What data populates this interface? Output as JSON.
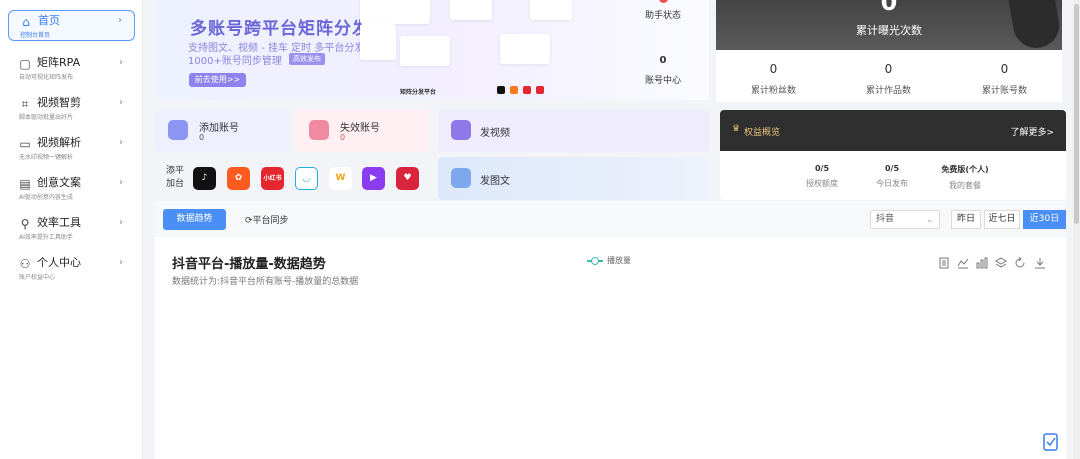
{
  "sidebar": {
    "items": [
      {
        "label": "首页",
        "sub": "控制台首页",
        "icon": "home-icon"
      },
      {
        "label": "矩阵RPA",
        "sub": "自动可视化矩阵发布",
        "icon": "rpa-icon"
      },
      {
        "label": "视频智剪",
        "sub": "脚本驱动批量出好片",
        "icon": "scissors-icon"
      },
      {
        "label": "视频解析",
        "sub": "无水印视频一键解析",
        "icon": "video-parse-icon"
      },
      {
        "label": "创意文案",
        "sub": "AI驱动创意内容生成",
        "icon": "copywriting-icon"
      },
      {
        "label": "效率工具",
        "sub": "AI效率提升工具助手",
        "icon": "tools-icon"
      },
      {
        "label": "个人中心",
        "sub": "账户权益中心",
        "icon": "user-icon"
      }
    ]
  },
  "banner": {
    "title": "多账号跨平台矩阵分发",
    "sub1": "支持图文、视频 - 挂车 定时 多平台分发",
    "sub2": "1000+账号同步管理",
    "tag": "高效发布",
    "button": "前去使用>>",
    "platform_title": "矩阵分发平台"
  },
  "assistant": {
    "status_label": "助手状态",
    "center_value": "0",
    "center_label": "账号中心"
  },
  "exposure": {
    "value": "0",
    "label": "累计曝光次数"
  },
  "totals": [
    {
      "value": "0",
      "label": "累计粉丝数"
    },
    {
      "value": "0",
      "label": "累计作品数"
    },
    {
      "value": "0",
      "label": "累计账号数"
    }
  ],
  "actions": {
    "add_account": {
      "label": "添加账号",
      "value": "0"
    },
    "invalid_account": {
      "label": "失效账号",
      "value": "0"
    },
    "post_video": {
      "label": "发视频"
    },
    "post_image": {
      "label": "发图文"
    },
    "add_platform": "添平加台"
  },
  "platforms": [
    {
      "name": "douyin-icon",
      "glyph": "♪",
      "color": "#111111"
    },
    {
      "name": "kuaishou-icon",
      "glyph": "✿",
      "color": "#ff5a1f"
    },
    {
      "name": "xiaohongshu-icon",
      "glyph": "小红书",
      "color": "#e6262e"
    },
    {
      "name": "bilibili-icon",
      "glyph": "◡",
      "color": "#ffffff"
    },
    {
      "name": "wechat-channels-icon",
      "glyph": "W",
      "color": "#ffffff"
    },
    {
      "name": "video-play-icon",
      "glyph": "▶",
      "color": "#8b3cf0"
    },
    {
      "name": "weishi-icon",
      "glyph": "♥",
      "color": "#d8243c"
    }
  ],
  "benefits": {
    "title": "权益概览",
    "more": "了解更多>",
    "stats": [
      {
        "value": "0/5",
        "label": "授权额度"
      },
      {
        "value": "0/5",
        "label": "今日发布"
      },
      {
        "value": "免费版(个人)",
        "label": "我的套餐"
      }
    ]
  },
  "tabs": {
    "trend": "数据趋势",
    "sync": "平台同步",
    "platform_select": "抖音",
    "ranges": [
      "昨日",
      "近七日",
      "近30日"
    ],
    "active_range": 2
  },
  "chart": {
    "title": "抖音平台-播放量-数据趋势",
    "description": "数据统计为:抖音平台所有账号-播放量的总数据",
    "legend": "播放量",
    "accent": "#3bb8b0"
  }
}
